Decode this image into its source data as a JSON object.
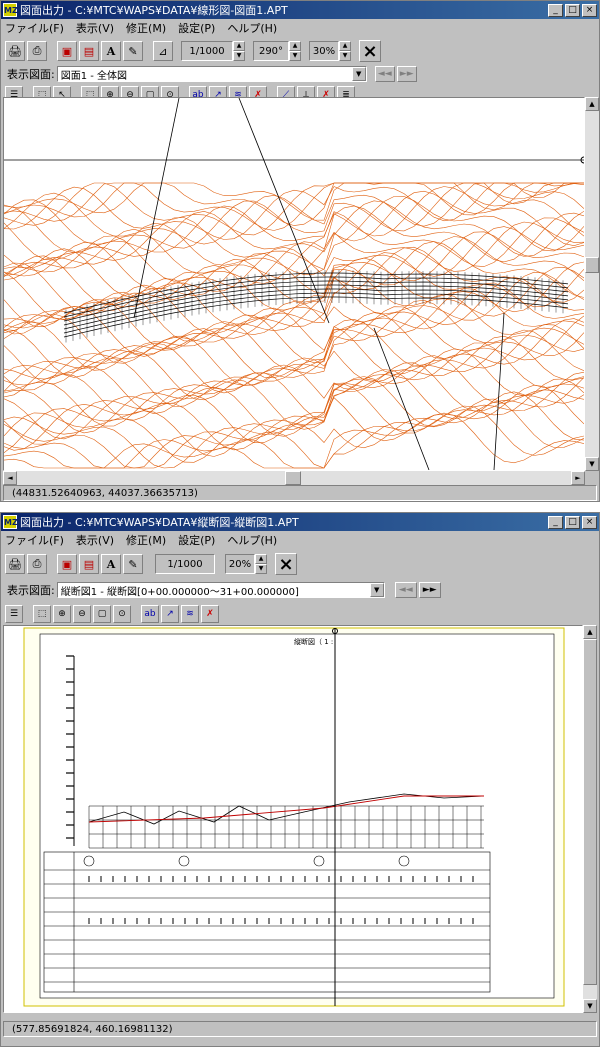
{
  "app_icon": "MZ",
  "window1": {
    "title": "図面出力 - C:¥MTC¥WAPS¥DATA¥線形図-図面1.APT",
    "menu": [
      "ファイル(F)",
      "表示(V)",
      "修正(M)",
      "設定(P)",
      "ヘルプ(H)"
    ],
    "scale_value": "1/1000",
    "angle_value": "290°",
    "zoom_value": "30%",
    "display_label": "表示図面:",
    "display_value": "図面1 - 全体図",
    "status_coords": "(44831.52640963, 44037.36635713)"
  },
  "window2": {
    "title": "図面出力 - C:¥MTC¥WAPS¥DATA¥縦断図-縦断図1.APT",
    "menu": [
      "ファイル(F)",
      "表示(V)",
      "修正(M)",
      "設定(P)",
      "ヘルプ(H)"
    ],
    "scale_value": "1/1000",
    "zoom_value": "20%",
    "display_label": "表示図面:",
    "display_value": "縦断図1 - 縦断図[0+00.000000～31+00.000000]",
    "drawing_title": "縦断図（ 1 : ",
    "status_coords": "(577.85691824, 460.16981132)"
  },
  "icons": {
    "minimize": "_",
    "maximize": "□",
    "close": "×",
    "print": "print-icon",
    "close_x": "×",
    "prev": "◄◄",
    "next": "►►"
  },
  "colors": {
    "contour": "#e06010",
    "title_active": "#0a246a",
    "road_profile": "#c00000"
  }
}
